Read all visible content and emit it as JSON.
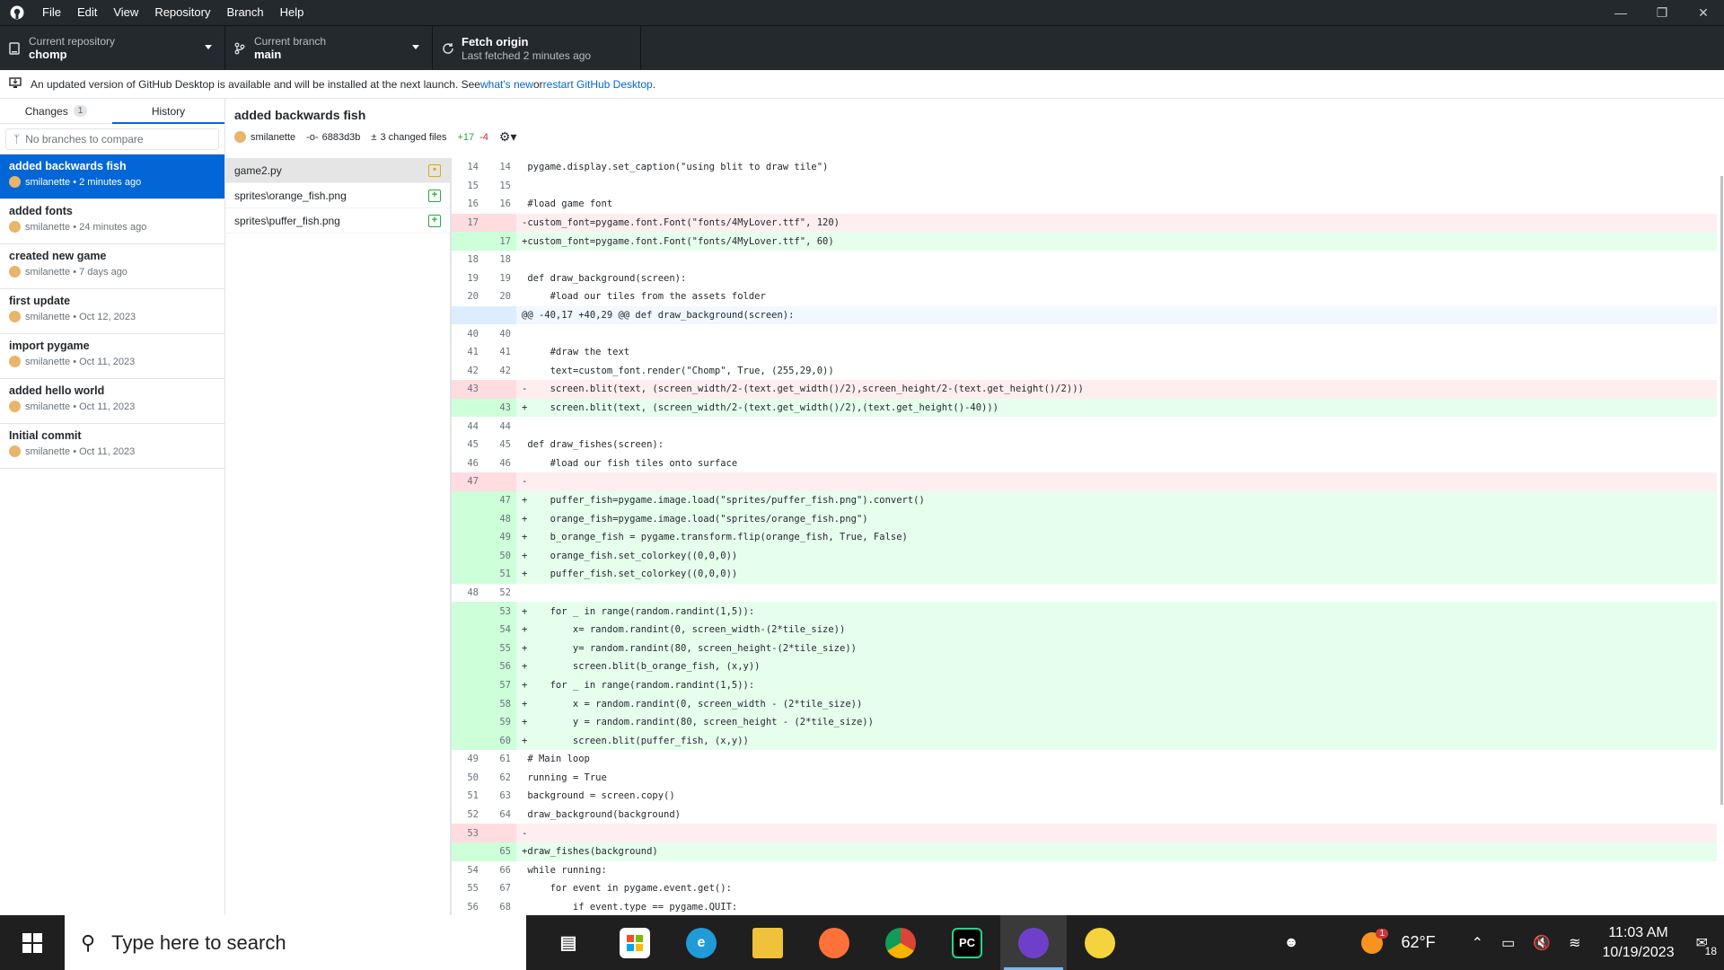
{
  "menu": [
    "File",
    "Edit",
    "View",
    "Repository",
    "Branch",
    "Help"
  ],
  "toolbar": {
    "repo_label": "Current repository",
    "repo_value": "chomp",
    "branch_label": "Current branch",
    "branch_value": "main",
    "fetch_label": "Fetch origin",
    "fetch_value": "Last fetched 2 minutes ago"
  },
  "banner": {
    "text": "An updated version of GitHub Desktop is available and will be installed at the next launch. See ",
    "link1": "what's new",
    "mid": " or ",
    "link2": "restart GitHub Desktop",
    "end": "."
  },
  "tabs": {
    "changes": "Changes",
    "changes_count": "1",
    "history": "History"
  },
  "branch_compare": "No branches to compare",
  "commits": [
    {
      "message": "added backwards fish",
      "author": "smilanette",
      "time": "2 minutes ago"
    },
    {
      "message": "added fonts",
      "author": "smilanette",
      "time": "24 minutes ago"
    },
    {
      "message": "created new game",
      "author": "smilanette",
      "time": "7 days ago"
    },
    {
      "message": "first update",
      "author": "smilanette",
      "time": "Oct 12, 2023"
    },
    {
      "message": "import pygame",
      "author": "smilanette",
      "time": "Oct 11, 2023"
    },
    {
      "message": "added hello world",
      "author": "smilanette",
      "time": "Oct 11, 2023"
    },
    {
      "message": "Initial commit",
      "author": "smilanette",
      "time": "Oct 11, 2023"
    }
  ],
  "commit_header": {
    "title": "added backwards fish",
    "author": "smilanette",
    "sha": "6883d3b",
    "changed": "3 changed files",
    "added": "+17",
    "removed": "-4"
  },
  "files": [
    {
      "name": "game2.py",
      "status": "modified"
    },
    {
      "name": "sprites\\orange_fish.png",
      "status": "added"
    },
    {
      "name": "sprites\\puffer_fish.png",
      "status": "added"
    }
  ],
  "diff": [
    {
      "t": "ctx",
      "o": "14",
      "n": "14",
      "c": " pygame.display.set_caption(\"using blit to draw tile\")"
    },
    {
      "t": "ctx",
      "o": "15",
      "n": "15",
      "c": ""
    },
    {
      "t": "ctx",
      "o": "16",
      "n": "16",
      "c": " #load game font"
    },
    {
      "t": "del",
      "o": "17",
      "n": "",
      "c": "-custom_font=pygame.font.Font(\"fonts/4MyLover.ttf\", 120)"
    },
    {
      "t": "add",
      "o": "",
      "n": "17",
      "c": "+custom_font=pygame.font.Font(\"fonts/4MyLover.ttf\", 60)"
    },
    {
      "t": "ctx",
      "o": "18",
      "n": "18",
      "c": ""
    },
    {
      "t": "ctx",
      "o": "19",
      "n": "19",
      "c": " def draw_background(screen):"
    },
    {
      "t": "ctx",
      "o": "20",
      "n": "20",
      "c": "     #load our tiles from the assets folder"
    },
    {
      "t": "hunk",
      "o": "",
      "n": "",
      "c": "@@ -40,17 +40,29 @@ def draw_background(screen):"
    },
    {
      "t": "ctx",
      "o": "40",
      "n": "40",
      "c": ""
    },
    {
      "t": "ctx",
      "o": "41",
      "n": "41",
      "c": "     #draw the text"
    },
    {
      "t": "ctx",
      "o": "42",
      "n": "42",
      "c": "     text=custom_font.render(\"Chomp\", True, (255,29,0))"
    },
    {
      "t": "del",
      "o": "43",
      "n": "",
      "c": "-    screen.blit(text, (screen_width/2-(text.get_width()/2),screen_height/2-(text.get_height()/2)))"
    },
    {
      "t": "add",
      "o": "",
      "n": "43",
      "c": "+    screen.blit(text, (screen_width/2-(text.get_width()/2),(text.get_height()-40)))"
    },
    {
      "t": "ctx",
      "o": "44",
      "n": "44",
      "c": ""
    },
    {
      "t": "ctx",
      "o": "45",
      "n": "45",
      "c": " def draw_fishes(screen):"
    },
    {
      "t": "ctx",
      "o": "46",
      "n": "46",
      "c": "     #load our fish tiles onto surface"
    },
    {
      "t": "del",
      "o": "47",
      "n": "",
      "c": "-"
    },
    {
      "t": "add",
      "o": "",
      "n": "47",
      "c": "+    puffer_fish=pygame.image.load(\"sprites/puffer_fish.png\").convert()"
    },
    {
      "t": "add",
      "o": "",
      "n": "48",
      "c": "+    orange_fish=pygame.image.load(\"sprites/orange_fish.png\")"
    },
    {
      "t": "add",
      "o": "",
      "n": "49",
      "c": "+    b_orange_fish = pygame.transform.flip(orange_fish, True, False)"
    },
    {
      "t": "add",
      "o": "",
      "n": "50",
      "c": "+    orange_fish.set_colorkey((0,0,0))"
    },
    {
      "t": "add",
      "o": "",
      "n": "51",
      "c": "+    puffer_fish.set_colorkey((0,0,0))"
    },
    {
      "t": "ctx",
      "o": "48",
      "n": "52",
      "c": ""
    },
    {
      "t": "add",
      "o": "",
      "n": "53",
      "c": "+    for _ in range(random.randint(1,5)):"
    },
    {
      "t": "add",
      "o": "",
      "n": "54",
      "c": "+        x= random.randint(0, screen_width-(2*tile_size))"
    },
    {
      "t": "add",
      "o": "",
      "n": "55",
      "c": "+        y= random.randint(80, screen_height-(2*tile_size))"
    },
    {
      "t": "add",
      "o": "",
      "n": "56",
      "c": "+        screen.blit(b_orange_fish, (x,y))"
    },
    {
      "t": "add",
      "o": "",
      "n": "57",
      "c": "+    for _ in range(random.randint(1,5)):"
    },
    {
      "t": "add",
      "o": "",
      "n": "58",
      "c": "+        x = random.randint(0, screen_width - (2*tile_size))"
    },
    {
      "t": "add",
      "o": "",
      "n": "59",
      "c": "+        y = random.randint(80, screen_height - (2*tile_size))"
    },
    {
      "t": "add",
      "o": "",
      "n": "60",
      "c": "+        screen.blit(puffer_fish, (x,y))"
    },
    {
      "t": "ctx",
      "o": "49",
      "n": "61",
      "c": " # Main loop"
    },
    {
      "t": "ctx",
      "o": "50",
      "n": "62",
      "c": " running = True"
    },
    {
      "t": "ctx",
      "o": "51",
      "n": "63",
      "c": " background = screen.copy()"
    },
    {
      "t": "ctx",
      "o": "52",
      "n": "64",
      "c": " draw_background(background)"
    },
    {
      "t": "del",
      "o": "53",
      "n": "",
      "c": "-"
    },
    {
      "t": "add",
      "o": "",
      "n": "65",
      "c": "+draw_fishes(background)"
    },
    {
      "t": "ctx",
      "o": "54",
      "n": "66",
      "c": " while running:"
    },
    {
      "t": "ctx",
      "o": "55",
      "n": "67",
      "c": "     for event in pygame.event.get():"
    },
    {
      "t": "ctx",
      "o": "56",
      "n": "68",
      "c": "         if event.type == pygame.QUIT:"
    }
  ],
  "taskbar": {
    "search_placeholder": "Type here to search",
    "weather": "62°F",
    "weather_badge": "1",
    "time": "11:03 AM",
    "date": "10/19/2023",
    "notifications": "18"
  }
}
